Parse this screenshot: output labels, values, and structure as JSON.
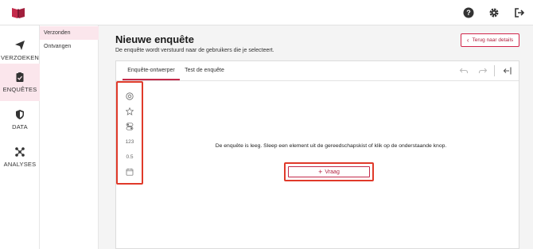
{
  "topbar": {
    "logo": "logo-book-icon",
    "icons": [
      "help-icon",
      "gear-icon",
      "logout-icon"
    ]
  },
  "nav": {
    "items": [
      {
        "label": "VERZOEKEN",
        "icon": "send-icon",
        "active": false
      },
      {
        "label": "ENQUÊTES",
        "icon": "clipboard-icon",
        "active": true
      },
      {
        "label": "DATA",
        "icon": "shield-icon",
        "active": false
      },
      {
        "label": "ANALYSES",
        "icon": "network-icon",
        "active": false
      }
    ]
  },
  "subnav": {
    "items": [
      {
        "label": "Verzonden",
        "active": true
      },
      {
        "label": "Ontvangen",
        "active": false
      }
    ]
  },
  "page": {
    "title": "Nieuwe enquête",
    "subtitle": "De enquête wordt verstuurd naar de gebruikers die je selecteert.",
    "back_label": "Terug naar details"
  },
  "editor": {
    "tabs": [
      {
        "label": "Enquête-ontwerper",
        "active": true
      },
      {
        "label": "Test de enquête",
        "active": false
      }
    ],
    "toolbar_icons": [
      "undo-icon",
      "redo-icon",
      "collapse-panel-icon"
    ],
    "toolbox": [
      {
        "icon": "radio-icon",
        "label": ""
      },
      {
        "icon": "star-icon",
        "label": ""
      },
      {
        "icon": "toggle-icon",
        "label": ""
      },
      {
        "icon": "number-icon",
        "label": "123"
      },
      {
        "icon": "decimal-icon",
        "label": "0.5"
      },
      {
        "icon": "calendar-icon",
        "label": ""
      }
    ],
    "empty_message": "De enquête is leeg. Sleep een element uit de gereedschapskist of klik op de onderstaande knop.",
    "add_button_label": "Vraag"
  },
  "colors": {
    "accent": "#c32a4a",
    "highlight": "#e03a2a",
    "active_bg": "#fbe6ec"
  }
}
